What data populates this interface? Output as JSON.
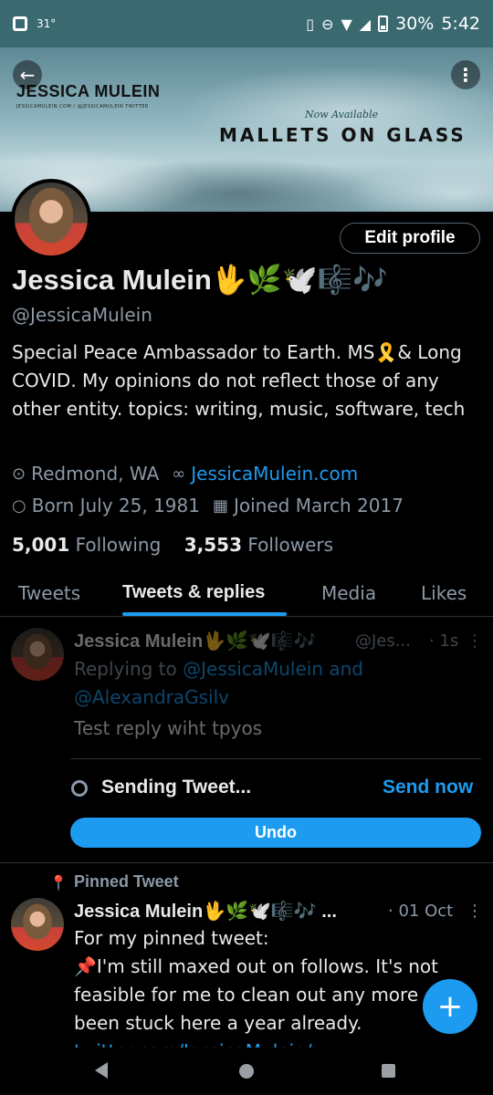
{
  "status_bar": {
    "temp": "31°",
    "battery": "30%",
    "time": "5:42"
  },
  "banner": {
    "name": "JESSICA MULEIN",
    "subtitle": "JESSICAMULEIN.COM / @JESSICAMULEIN TWITTER",
    "now_available": "Now Available",
    "album": "MALLETS ON GLASS"
  },
  "profile": {
    "edit_label": "Edit profile",
    "display_name": "Jessica Mulein🖖🌿🕊️🎼🎶",
    "handle": "@JessicaMulein",
    "bio": "Special Peace Ambassador to Earth. MS🎗️& Long COVID.  My opinions do not reflect those of any other entity.  topics: writing, music, software, tech",
    "location": "Redmond, WA",
    "website": "JessicaMulein.com",
    "born": "Born July 25, 1981",
    "joined": "Joined March 2017",
    "following_count": "5,001",
    "following_label": "Following",
    "followers_count": "3,553",
    "followers_label": "Followers"
  },
  "tabs": [
    "Tweets",
    "Tweets & replies",
    "Media",
    "Likes"
  ],
  "tweet_sending": {
    "name": "Jessica Mulein🖖🌿🕊️🎼🎶",
    "handle": "@Jes...",
    "time": "· 1s",
    "replying_prefix": "Replying to ",
    "replying_to_1": "@JessicaMulein",
    "replying_and": " and",
    "replying_to_2": "@AlexandraGsilv",
    "text": "Test reply wiht tpyos",
    "sending_label": "Sending Tweet...",
    "send_now_label": "Send now",
    "undo_label": "Undo"
  },
  "pinned_tweet": {
    "pinned_label": "Pinned Tweet",
    "name": "Jessica Mulein🖖🌿🕊️🎼🎶 ...",
    "time": "· 01 Oct",
    "line1": "For my pinned tweet:",
    "line2": "📌I'm still maxed out on follows. It's not",
    "line3": "feasible for me to clean out any more",
    "line4": "been stuck here a year already.",
    "line5": "twitter.com/JessicaMulein/"
  },
  "fab_label": "+",
  "colors": {
    "accent": "#1d9bf0",
    "muted": "#8b98a5",
    "status_bar": "#3a6a70"
  }
}
